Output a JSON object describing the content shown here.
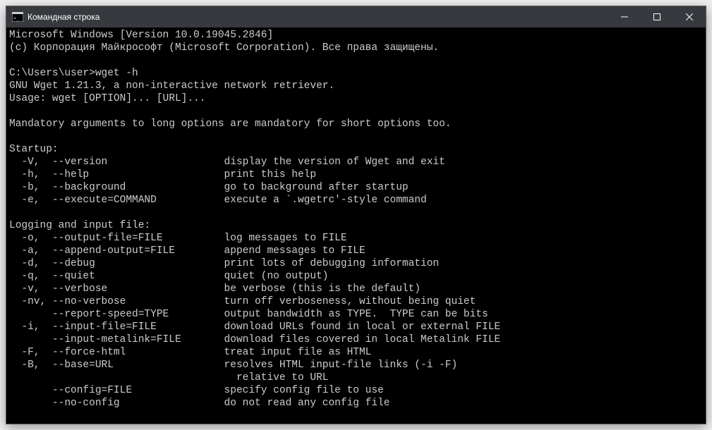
{
  "window": {
    "title": "Командная строка"
  },
  "terminal": {
    "lines": [
      "Microsoft Windows [Version 10.0.19045.2846]",
      "(c) Корпорация Майкрософт (Microsoft Corporation). Все права защищены.",
      "",
      "C:\\Users\\user>wget -h",
      "GNU Wget 1.21.3, a non-interactive network retriever.",
      "Usage: wget [OPTION]... [URL]...",
      "",
      "Mandatory arguments to long options are mandatory for short options too.",
      "",
      "Startup:",
      "  -V,  --version                   display the version of Wget and exit",
      "  -h,  --help                      print this help",
      "  -b,  --background                go to background after startup",
      "  -e,  --execute=COMMAND           execute a `.wgetrc'-style command",
      "",
      "Logging and input file:",
      "  -o,  --output-file=FILE          log messages to FILE",
      "  -a,  --append-output=FILE        append messages to FILE",
      "  -d,  --debug                     print lots of debugging information",
      "  -q,  --quiet                     quiet (no output)",
      "  -v,  --verbose                   be verbose (this is the default)",
      "  -nv, --no-verbose                turn off verboseness, without being quiet",
      "       --report-speed=TYPE         output bandwidth as TYPE.  TYPE can be bits",
      "  -i,  --input-file=FILE           download URLs found in local or external FILE",
      "       --input-metalink=FILE       download files covered in local Metalink FILE",
      "  -F,  --force-html                treat input file as HTML",
      "  -B,  --base=URL                  resolves HTML input-file links (-i -F)",
      "                                     relative to URL",
      "       --config=FILE               specify config file to use",
      "       --no-config                 do not read any config file"
    ]
  }
}
